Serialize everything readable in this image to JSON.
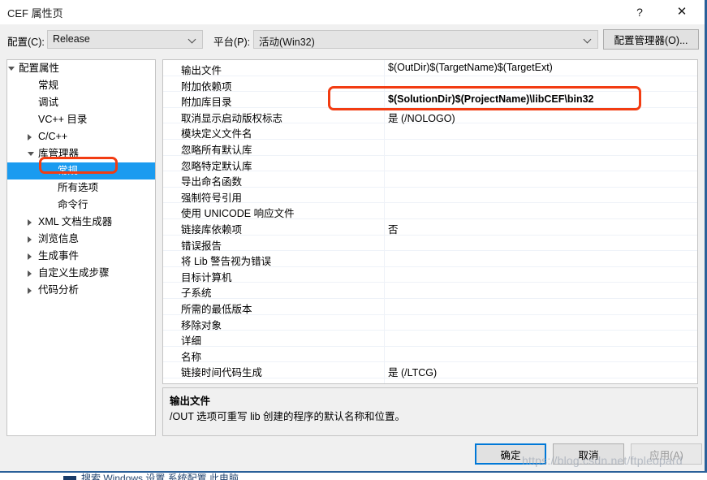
{
  "window": {
    "title": "CEF 属性页",
    "help_icon": "question-mark-icon",
    "close_icon": "close-icon"
  },
  "toolbar": {
    "config_label": "配置(C):",
    "config_value": "Release",
    "platform_label": "平台(P):",
    "platform_value": "活动(Win32)",
    "config_manager_label": "配置管理器(O)..."
  },
  "tree": {
    "items": [
      {
        "label": "配置属性",
        "indent": 14,
        "expander": "expanded",
        "selected": false
      },
      {
        "label": "常规",
        "indent": 38,
        "expander": "none",
        "selected": false
      },
      {
        "label": "调试",
        "indent": 38,
        "expander": "none",
        "selected": false
      },
      {
        "label": "VC++ 目录",
        "indent": 38,
        "expander": "none",
        "selected": false
      },
      {
        "label": "C/C++",
        "indent": 38,
        "expander": "collapsed",
        "selected": false
      },
      {
        "label": "库管理器",
        "indent": 38,
        "expander": "expanded",
        "selected": false
      },
      {
        "label": "常规",
        "indent": 62,
        "expander": "none",
        "selected": true
      },
      {
        "label": "所有选项",
        "indent": 62,
        "expander": "none",
        "selected": false
      },
      {
        "label": "命令行",
        "indent": 62,
        "expander": "none",
        "selected": false
      },
      {
        "label": "XML 文档生成器",
        "indent": 38,
        "expander": "collapsed",
        "selected": false
      },
      {
        "label": "浏览信息",
        "indent": 38,
        "expander": "collapsed",
        "selected": false
      },
      {
        "label": "生成事件",
        "indent": 38,
        "expander": "collapsed",
        "selected": false
      },
      {
        "label": "自定义生成步骤",
        "indent": 38,
        "expander": "collapsed",
        "selected": false
      },
      {
        "label": "代码分析",
        "indent": 38,
        "expander": "collapsed",
        "selected": false
      }
    ]
  },
  "grid": {
    "rows": [
      {
        "name": "输出文件",
        "value": "$(OutDir)$(TargetName)$(TargetExt)",
        "bold": false
      },
      {
        "name": "附加依赖项",
        "value": "",
        "bold": false
      },
      {
        "name": "附加库目录",
        "value": "$(SolutionDir)$(ProjectName)\\libCEF\\bin32",
        "bold": true
      },
      {
        "name": "取消显示启动版权标志",
        "value": "是 (/NOLOGO)",
        "bold": false
      },
      {
        "name": "模块定义文件名",
        "value": "",
        "bold": false
      },
      {
        "name": "忽略所有默认库",
        "value": "",
        "bold": false
      },
      {
        "name": "忽略特定默认库",
        "value": "",
        "bold": false
      },
      {
        "name": "导出命名函数",
        "value": "",
        "bold": false
      },
      {
        "name": "强制符号引用",
        "value": "",
        "bold": false
      },
      {
        "name": "使用 UNICODE 响应文件",
        "value": "",
        "bold": false
      },
      {
        "name": "链接库依赖项",
        "value": "否",
        "bold": false
      },
      {
        "name": "错误报告",
        "value": "",
        "bold": false
      },
      {
        "name": "将 Lib 警告视为错误",
        "value": "",
        "bold": false
      },
      {
        "name": "目标计算机",
        "value": "",
        "bold": false
      },
      {
        "name": "子系统",
        "value": "",
        "bold": false
      },
      {
        "name": "所需的最低版本",
        "value": "",
        "bold": false
      },
      {
        "name": "移除对象",
        "value": "",
        "bold": false
      },
      {
        "name": "详细",
        "value": "",
        "bold": false
      },
      {
        "name": "名称",
        "value": "",
        "bold": false
      },
      {
        "name": "链接时间代码生成",
        "value": "是 (/LTCG)",
        "bold": false
      }
    ]
  },
  "description": {
    "title": "输出文件",
    "body": "/OUT 选项可重写 lib 创建的程序的默认名称和位置。"
  },
  "footer": {
    "ok_label": "确定",
    "cancel_label": "取消",
    "apply_label": "应用(A)"
  },
  "annotations": {
    "color": "#f23c12",
    "value_highlight": "附加库目录 value",
    "tree_highlight": "库管理器 > 常规"
  },
  "watermark": {
    "text": "https://blog.csdn.net/ftpleopard"
  },
  "taskbar": {
    "text": "搜索  Windows  设置  系统配置  此电脑"
  }
}
